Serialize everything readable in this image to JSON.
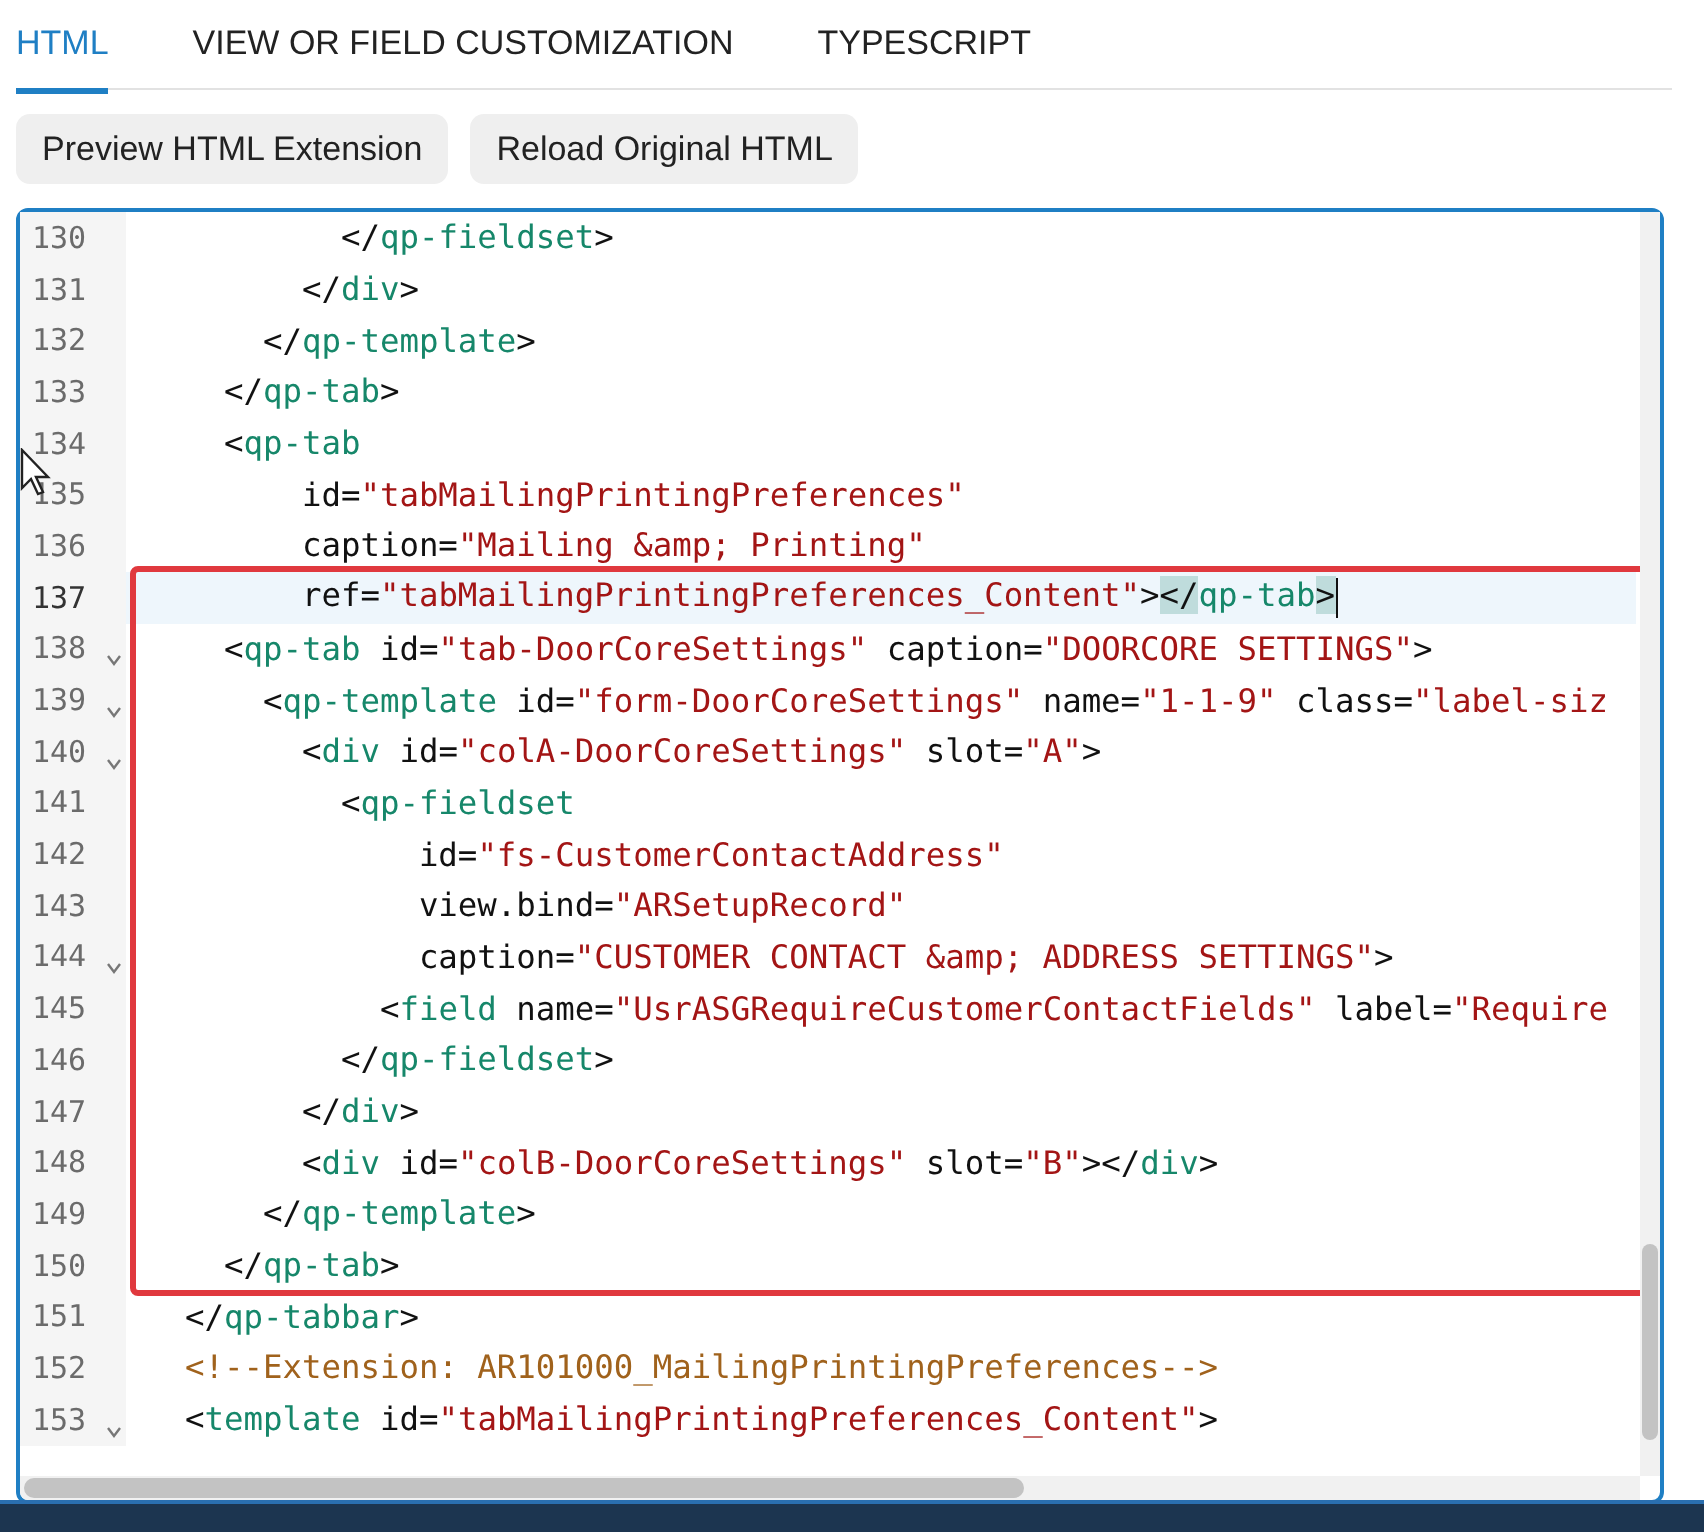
{
  "tabs": [
    {
      "label": "HTML",
      "selected": true
    },
    {
      "label": "VIEW OR FIELD CUSTOMIZATION",
      "selected": false
    },
    {
      "label": "TYPESCRIPT",
      "selected": false
    }
  ],
  "buttons": [
    "Preview HTML Extension",
    "Reload Original HTML"
  ],
  "editor": {
    "sections": [
      {
        "boxed": false,
        "lines": [
          {
            "number": "130",
            "fold": false,
            "current": false,
            "tokens": [
              {
                "kind": "text",
                "text": "          </"
              },
              {
                "kind": "tag",
                "text": "qp-fieldset"
              },
              {
                "kind": "text",
                "text": ">"
              }
            ]
          },
          {
            "number": "131",
            "fold": false,
            "current": false,
            "tokens": [
              {
                "kind": "text",
                "text": "        </"
              },
              {
                "kind": "tag",
                "text": "div"
              },
              {
                "kind": "text",
                "text": ">"
              }
            ]
          },
          {
            "number": "132",
            "fold": false,
            "current": false,
            "tokens": [
              {
                "kind": "text",
                "text": "      </"
              },
              {
                "kind": "tag",
                "text": "qp-template"
              },
              {
                "kind": "text",
                "text": ">"
              }
            ]
          },
          {
            "number": "133",
            "fold": false,
            "current": false,
            "tokens": [
              {
                "kind": "text",
                "text": "    </"
              },
              {
                "kind": "tag",
                "text": "qp-tab"
              },
              {
                "kind": "text",
                "text": ">"
              }
            ]
          },
          {
            "number": "134",
            "fold": false,
            "current": false,
            "tokens": [
              {
                "kind": "text",
                "text": "    <"
              },
              {
                "kind": "tag",
                "text": "qp-tab"
              }
            ]
          },
          {
            "number": "135",
            "fold": false,
            "current": false,
            "tokens": [
              {
                "kind": "text",
                "text": "        id="
              },
              {
                "kind": "value",
                "text": "\"tabMailingPrintingPreferences\""
              }
            ]
          },
          {
            "number": "136",
            "fold": false,
            "current": false,
            "tokens": [
              {
                "kind": "text",
                "text": "        caption="
              },
              {
                "kind": "value",
                "text": "\"Mailing &amp; Printing\""
              }
            ]
          }
        ]
      },
      {
        "boxed": true,
        "lines": [
          {
            "number": "137",
            "fold": false,
            "current": true,
            "tokens": [
              {
                "kind": "text",
                "text": "        ref="
              },
              {
                "kind": "value",
                "text": "\"tabMailingPrintingPreferences_Content\""
              },
              {
                "kind": "text",
                "text": ">"
              },
              {
                "kind": "match",
                "text": "</"
              },
              {
                "kind": "tag",
                "text": "qp-tab"
              },
              {
                "kind": "match",
                "text": ">"
              }
            ]
          },
          {
            "number": "138",
            "fold": true,
            "current": false,
            "tokens": [
              {
                "kind": "text",
                "text": "    <"
              },
              {
                "kind": "tag",
                "text": "qp-tab"
              },
              {
                "kind": "text",
                "text": " id="
              },
              {
                "kind": "value",
                "text": "\"tab-DoorCoreSettings\""
              },
              {
                "kind": "text",
                "text": " caption="
              },
              {
                "kind": "value",
                "text": "\"DOORCORE SETTINGS\""
              },
              {
                "kind": "text",
                "text": ">"
              }
            ]
          },
          {
            "number": "139",
            "fold": true,
            "current": false,
            "tokens": [
              {
                "kind": "text",
                "text": "      <"
              },
              {
                "kind": "tag",
                "text": "qp-template"
              },
              {
                "kind": "text",
                "text": " id="
              },
              {
                "kind": "value",
                "text": "\"form-DoorCoreSettings\""
              },
              {
                "kind": "text",
                "text": " name="
              },
              {
                "kind": "value",
                "text": "\"1-1-9\""
              },
              {
                "kind": "text",
                "text": " class="
              },
              {
                "kind": "value",
                "text": "\"label-siz"
              }
            ]
          },
          {
            "number": "140",
            "fold": true,
            "current": false,
            "tokens": [
              {
                "kind": "text",
                "text": "        <"
              },
              {
                "kind": "tag",
                "text": "div"
              },
              {
                "kind": "text",
                "text": " id="
              },
              {
                "kind": "value",
                "text": "\"colA-DoorCoreSettings\""
              },
              {
                "kind": "text",
                "text": " slot="
              },
              {
                "kind": "value",
                "text": "\"A\""
              },
              {
                "kind": "text",
                "text": ">"
              }
            ]
          },
          {
            "number": "141",
            "fold": false,
            "current": false,
            "tokens": [
              {
                "kind": "text",
                "text": "          <"
              },
              {
                "kind": "tag",
                "text": "qp-fieldset"
              }
            ]
          },
          {
            "number": "142",
            "fold": false,
            "current": false,
            "tokens": [
              {
                "kind": "text",
                "text": "              id="
              },
              {
                "kind": "value",
                "text": "\"fs-CustomerContactAddress\""
              }
            ]
          },
          {
            "number": "143",
            "fold": false,
            "current": false,
            "tokens": [
              {
                "kind": "text",
                "text": "              view.bind="
              },
              {
                "kind": "value",
                "text": "\"ARSetupRecord\""
              }
            ]
          },
          {
            "number": "144",
            "fold": true,
            "current": false,
            "tokens": [
              {
                "kind": "text",
                "text": "              caption="
              },
              {
                "kind": "value",
                "text": "\"CUSTOMER CONTACT &amp; ADDRESS SETTINGS\""
              },
              {
                "kind": "text",
                "text": ">"
              }
            ]
          },
          {
            "number": "145",
            "fold": false,
            "current": false,
            "tokens": [
              {
                "kind": "text",
                "text": "            <"
              },
              {
                "kind": "tag",
                "text": "field"
              },
              {
                "kind": "text",
                "text": " name="
              },
              {
                "kind": "value",
                "text": "\"UsrASGRequireCustomerContactFields\""
              },
              {
                "kind": "text",
                "text": " label="
              },
              {
                "kind": "value",
                "text": "\"Require"
              }
            ]
          },
          {
            "number": "146",
            "fold": false,
            "current": false,
            "tokens": [
              {
                "kind": "text",
                "text": "          </"
              },
              {
                "kind": "tag",
                "text": "qp-fieldset"
              },
              {
                "kind": "text",
                "text": ">"
              }
            ]
          },
          {
            "number": "147",
            "fold": false,
            "current": false,
            "tokens": [
              {
                "kind": "text",
                "text": "        </"
              },
              {
                "kind": "tag",
                "text": "div"
              },
              {
                "kind": "text",
                "text": ">"
              }
            ]
          },
          {
            "number": "148",
            "fold": false,
            "current": false,
            "tokens": [
              {
                "kind": "text",
                "text": "        <"
              },
              {
                "kind": "tag",
                "text": "div"
              },
              {
                "kind": "text",
                "text": " id="
              },
              {
                "kind": "value",
                "text": "\"colB-DoorCoreSettings\""
              },
              {
                "kind": "text",
                "text": " slot="
              },
              {
                "kind": "value",
                "text": "\"B\""
              },
              {
                "kind": "text",
                "text": "></"
              },
              {
                "kind": "tag",
                "text": "div"
              },
              {
                "kind": "text",
                "text": ">"
              }
            ]
          },
          {
            "number": "149",
            "fold": false,
            "current": false,
            "tokens": [
              {
                "kind": "text",
                "text": "      </"
              },
              {
                "kind": "tag",
                "text": "qp-template"
              },
              {
                "kind": "text",
                "text": ">"
              }
            ]
          },
          {
            "number": "150",
            "fold": false,
            "current": false,
            "tokens": [
              {
                "kind": "text",
                "text": "    </"
              },
              {
                "kind": "tag",
                "text": "qp-tab"
              },
              {
                "kind": "text",
                "text": ">"
              }
            ]
          }
        ]
      },
      {
        "boxed": false,
        "lines": [
          {
            "number": "151",
            "fold": false,
            "current": false,
            "tokens": [
              {
                "kind": "text",
                "text": "  </"
              },
              {
                "kind": "tag",
                "text": "qp-tabbar"
              },
              {
                "kind": "text",
                "text": ">"
              }
            ]
          },
          {
            "number": "152",
            "fold": false,
            "current": false,
            "tokens": [
              {
                "kind": "comment",
                "text": "  <!--Extension: AR101000_MailingPrintingPreferences-->"
              }
            ]
          },
          {
            "number": "153",
            "fold": true,
            "current": false,
            "tokens": [
              {
                "kind": "text",
                "text": "  <"
              },
              {
                "kind": "tag",
                "text": "template"
              },
              {
                "kind": "text",
                "text": " id="
              },
              {
                "kind": "value",
                "text": "\"tabMailingPrintingPreferences_Content\""
              },
              {
                "kind": "text",
                "text": ">"
              }
            ]
          }
        ]
      }
    ]
  }
}
